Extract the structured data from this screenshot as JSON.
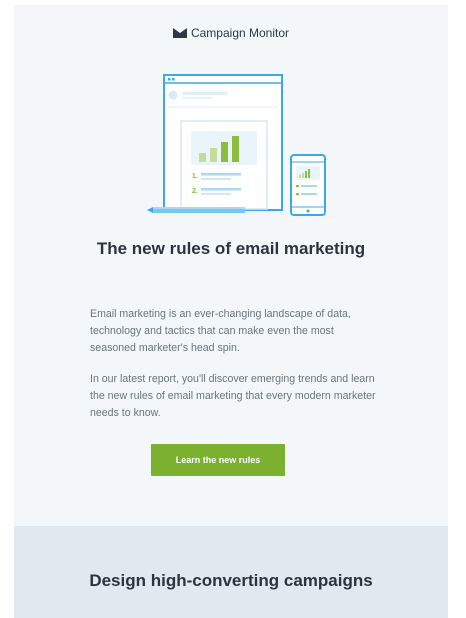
{
  "brand": {
    "name": "Campaign Monitor",
    "icon": "envelope-logo-icon"
  },
  "hero": {
    "illustration": "report-browser-and-phone-illustration",
    "list_numbers": [
      "1.",
      "2."
    ],
    "colors": {
      "outline": "#3aa9e8",
      "bar_green": "#8bbd3e",
      "bar_light": "#c5dc9a",
      "line_blue": "#a9d8f5"
    }
  },
  "main": {
    "title": "The new rules of email marketing",
    "paragraph_1": "Email marketing is an ever-changing landscape of data, technology and tactics that can make even the most seasoned marketer's head spin.",
    "paragraph_2": "In our latest report, you'll discover emerging trends and learn the new rules of email marketing that every modern marketer needs to know.",
    "cta_label": "Learn the new rules"
  },
  "section2": {
    "title": "Design high-converting campaigns"
  },
  "colors": {
    "cta": "#7bb12e",
    "card_bg": "#f3f7fa",
    "section2_bg": "#dfe9ef",
    "heading": "#2b3440"
  }
}
